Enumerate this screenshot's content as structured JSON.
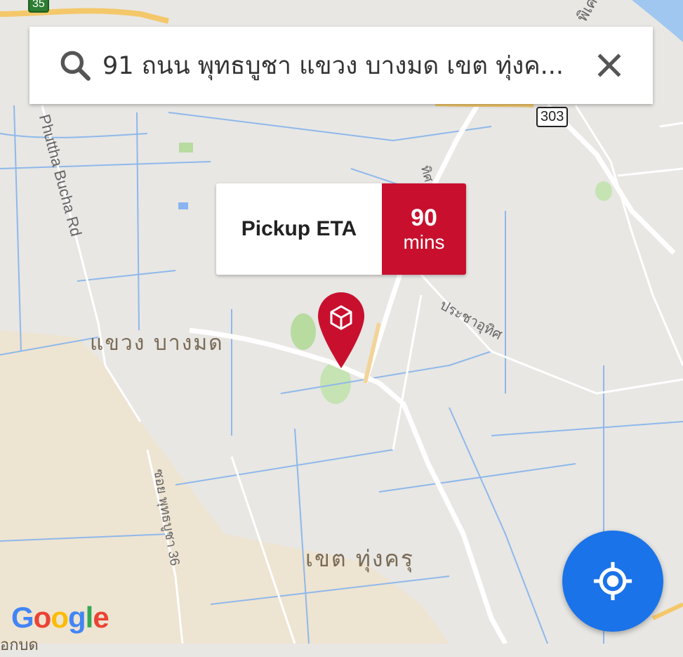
{
  "search": {
    "query": "91 ถนน พุทธบูชา แขวง บางมด เขต ทุ่งค...",
    "search_icon": "search-icon",
    "close_icon": "close-icon"
  },
  "eta": {
    "label": "Pickup ETA",
    "value": "90",
    "unit": "mins",
    "accent": "#c8102e"
  },
  "map": {
    "area_labels": [
      "แขวง บางมด",
      "เขต ทุ่งครุ"
    ],
    "road_labels": [
      "Phuttha Bucha Rd",
      "ประชาอุทิศ",
      "ซอย พุทธบูชา 36",
      "ทิศ",
      "พิเศ"
    ],
    "route_shields": [
      "303",
      "35"
    ],
    "partial_label": "อกบด"
  },
  "marker": {
    "icon": "package-icon",
    "color": "#c8102e"
  },
  "my_location": {
    "icon": "my-location-icon",
    "color": "#1a73e8"
  },
  "attribution": {
    "logo_text": "Google",
    "logo_letters": [
      "G",
      "o",
      "o",
      "g",
      "l",
      "e"
    ],
    "logo_colors": [
      "#4285F4",
      "#EA4335",
      "#FBBC05",
      "#4285F4",
      "#34A853",
      "#EA4335"
    ]
  }
}
